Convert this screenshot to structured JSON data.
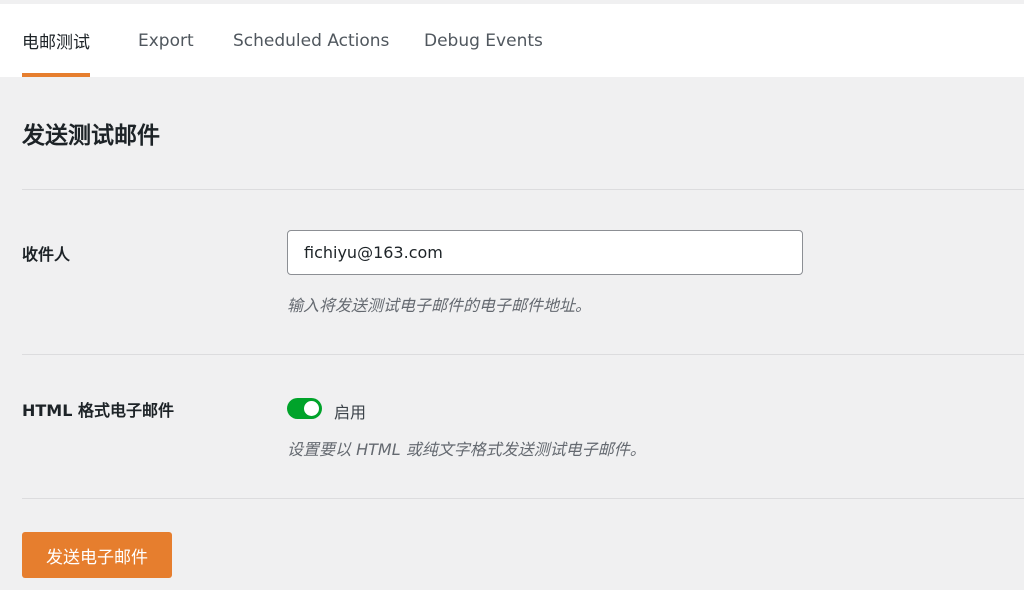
{
  "tabs": [
    {
      "label": "电邮测试",
      "active": true
    },
    {
      "label": "Export",
      "active": false
    },
    {
      "label": "Scheduled Actions",
      "active": false
    },
    {
      "label": "Debug Events",
      "active": false
    }
  ],
  "section_title": "发送测试邮件",
  "recipient": {
    "label": "收件人",
    "value": "fichiyu@163.com",
    "help": "输入将发送测试电子邮件的电子邮件地址。"
  },
  "html_email": {
    "label": "HTML 格式电子邮件",
    "toggle_on": true,
    "toggle_label": "启用",
    "help": "设置要以 HTML 或纯文字格式发送测试电子邮件。"
  },
  "send_button_label": "发送电子邮件",
  "colors": {
    "accent": "#e67e2e",
    "toggle_on": "#00a32a"
  }
}
